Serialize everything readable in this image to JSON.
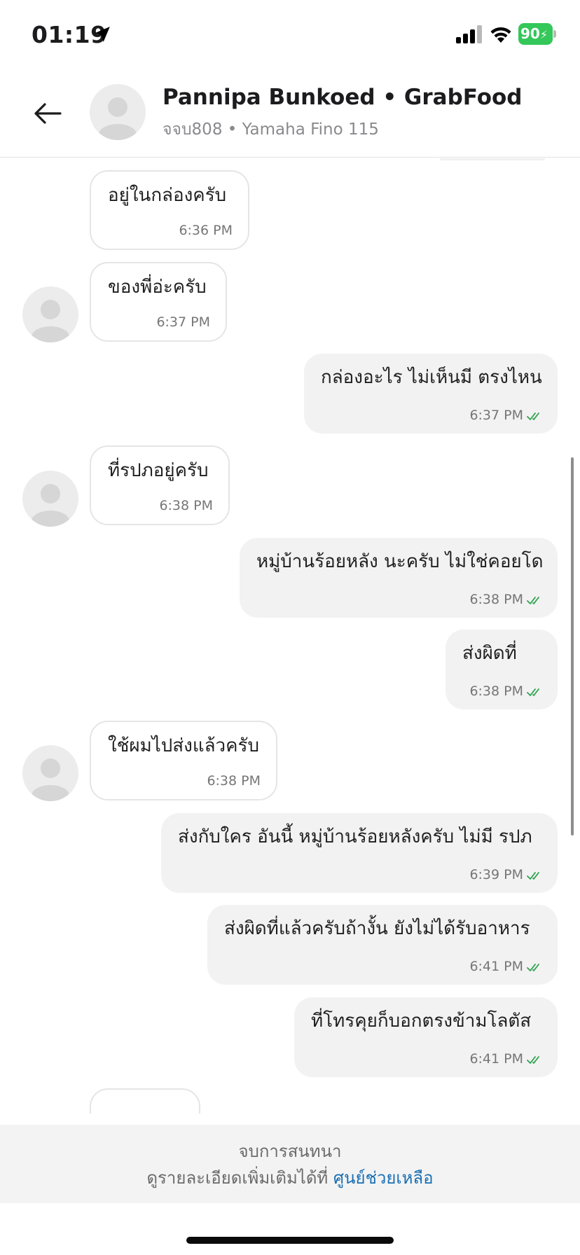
{
  "status_bar": {
    "time": "01:19",
    "battery": "90",
    "icons": [
      "location-arrow-icon",
      "signal-icon",
      "wifi-icon",
      "battery-charging-icon"
    ],
    "battery_color": "#34c759"
  },
  "header": {
    "back_icon": "arrow-left-icon",
    "contact_name": "Pannipa Bunkoed • GrabFood",
    "subtitle": "จจบ808 • Yamaha Fino 115"
  },
  "messages": [
    {
      "direction": "incoming",
      "text": "อยู่ในกล่องครับ",
      "time": "6:36 PM",
      "avatar": false
    },
    {
      "direction": "incoming",
      "text": "ของพี่อ่ะครับ",
      "time": "6:37 PM",
      "avatar": true
    },
    {
      "direction": "outgoing",
      "text": "กล่องอะไร ไม่เห็นมี ตรงไหน",
      "time": "6:37 PM",
      "read": true
    },
    {
      "direction": "incoming",
      "text": "ที่รปภอยู่ครับ",
      "time": "6:38 PM",
      "avatar": true
    },
    {
      "direction": "outgoing",
      "text": "หมู่บ้านร้อยหลัง นะครับ ไม่ใช่คอยโด",
      "time": "6:38 PM",
      "read": true
    },
    {
      "direction": "outgoing",
      "text": "ส่งผิดที่",
      "time": "6:38 PM",
      "read": true
    },
    {
      "direction": "incoming",
      "text": "ใช้ผมไปส่งแล้วครับ",
      "time": "6:38 PM",
      "avatar": true
    },
    {
      "direction": "outgoing",
      "text": "ส่งกับใคร อันนี้ หมู่บ้านร้อยหลังครับ ไม่มี รปภ",
      "time": "6:39 PM",
      "read": true
    },
    {
      "direction": "outgoing",
      "text": "ส่งผิดที่แล้วครับถ้างั้น ยังไม่ได้รับอาหาร",
      "time": "6:41 PM",
      "read": true
    },
    {
      "direction": "outgoing",
      "text": "ที่โทรคุยก็บอกตรงข้ามโลตัส",
      "time": "6:41 PM",
      "read": true
    }
  ],
  "footer": {
    "title": "จบการสนทนา",
    "detail_text": "ดูรายละเอียดเพิ่มเติมได้ที่ ",
    "help_link": "ศูนย์ช่วยเหลือ",
    "link_color": "#1a6fb3"
  },
  "colors": {
    "read_tick": "#2fa34f",
    "outgoing_bubble": "#f2f2f2",
    "incoming_border": "#e5e5e5"
  }
}
